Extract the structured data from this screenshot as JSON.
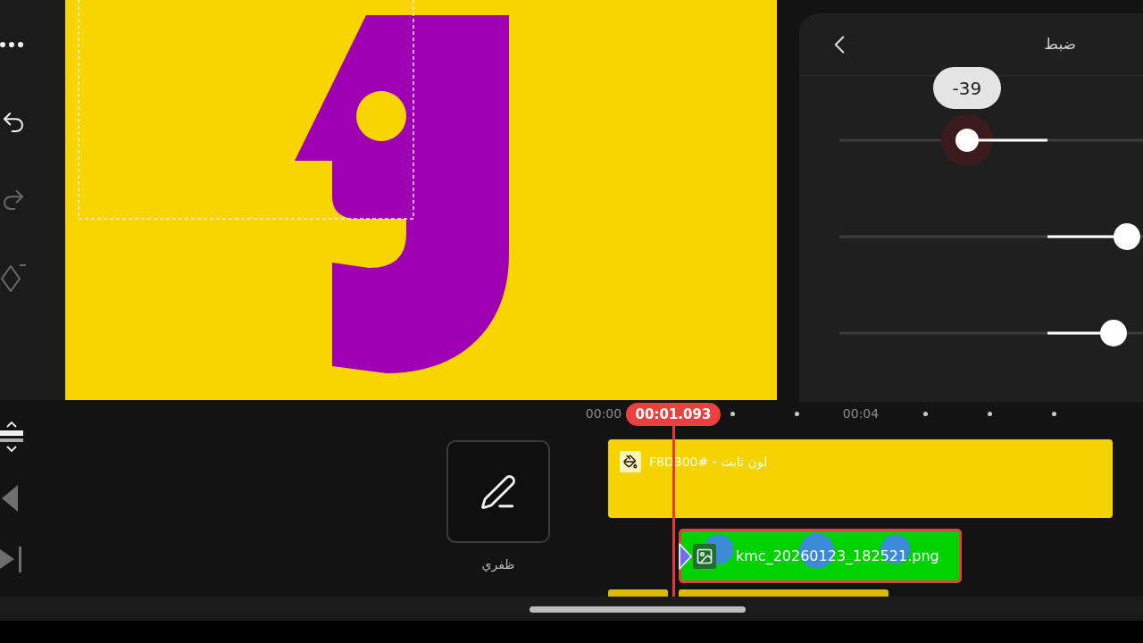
{
  "toolbar": {
    "items": [
      {
        "kind": "more",
        "disabled": false
      },
      {
        "kind": "undo",
        "disabled": false
      },
      {
        "kind": "redo",
        "disabled": true
      },
      {
        "kind": "keyframe",
        "disabled": true
      }
    ]
  },
  "panel": {
    "title": "ضبط",
    "sliders": [
      {
        "level": 0.42,
        "active": true,
        "tooltip": "-39"
      },
      {
        "level": 0.947,
        "active": false
      },
      {
        "level": 0.903,
        "active": false
      }
    ]
  },
  "timeline_tools": [
    {
      "kind": "expand",
      "disabled": false
    },
    {
      "kind": "previous",
      "disabled": true
    },
    {
      "kind": "to-end",
      "disabled": true
    }
  ],
  "edit_tool": {
    "label": "ظفري"
  },
  "timeline": {
    "ruler": {
      "first_label": "00:00",
      "second_label": "00:04"
    },
    "playhead": "00:01.093",
    "clips": [
      {
        "kind": "color",
        "label": "لون ثابت - #F8D300",
        "selected": false
      },
      {
        "kind": "image",
        "label": "kmc_20260123_182521.png",
        "selected": true
      }
    ]
  }
}
